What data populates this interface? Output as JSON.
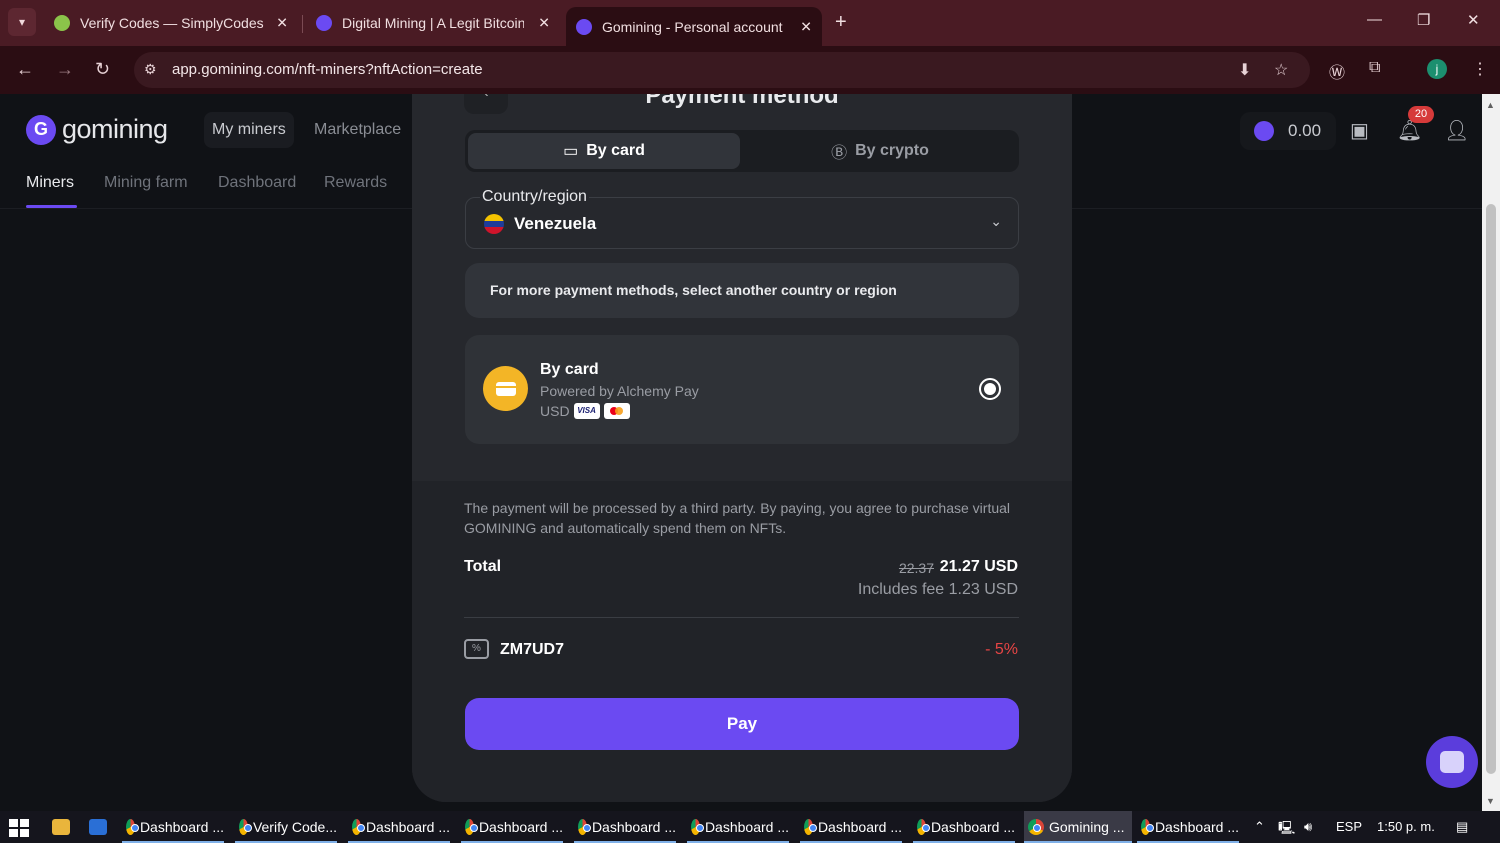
{
  "browser": {
    "tabs": [
      {
        "title": "Verify Codes — SimplyCodes",
        "active": false
      },
      {
        "title": "Digital Mining | A Legit Bitcoin",
        "active": false
      },
      {
        "title": "Gomining - Personal account",
        "active": true
      }
    ],
    "url": "app.gomining.com/nft-miners?nftAction=create",
    "profile_initial": "j"
  },
  "site": {
    "logo_text": "gomining",
    "top_nav": [
      "My miners",
      "Marketplace"
    ],
    "sub_nav": [
      "Miners",
      "Mining farm",
      "Dashboard",
      "Rewards"
    ],
    "balance": "0.00",
    "notification_count": "20"
  },
  "modal": {
    "title": "Payment method",
    "tabs": {
      "card": "By card",
      "crypto": "By crypto"
    },
    "country_label": "Country/region",
    "country_value": "Venezuela",
    "info": "For more payment methods, select another country or region",
    "method": {
      "title": "By card",
      "subtitle": "Powered by Alchemy Pay",
      "currency": "USD",
      "visa": "VISA"
    },
    "disclaimer": "The payment will be processed by a third party. By paying, you agree to purchase virtual GOMINING and automatically spend them on NFTs.",
    "total_label": "Total",
    "total_old": "22.37",
    "total_new": "21.27 USD",
    "fee": "Includes fee 1.23 USD",
    "promo_code": "ZM7UD7",
    "promo_discount": "- 5%",
    "pay_label": "Pay"
  },
  "taskbar": {
    "items": [
      "Dashboard ...",
      "Verify Code...",
      "Dashboard ...",
      "Dashboard ...",
      "Dashboard ...",
      "Dashboard ...",
      "Dashboard ...",
      "Dashboard ...",
      "Gomining ...",
      "Dashboard ..."
    ],
    "language": "ESP",
    "time": "1:50 p. m."
  },
  "colors": {
    "accent": "#6b4af2",
    "discount": "#e64545",
    "card_icon": "#f3b526"
  }
}
